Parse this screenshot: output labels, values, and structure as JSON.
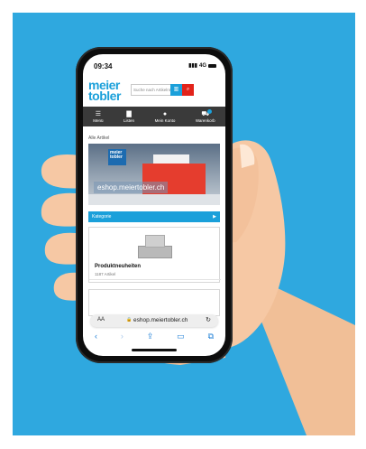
{
  "status": {
    "time": "09:34",
    "network": "4G"
  },
  "header": {
    "logo_line1": "meier",
    "logo_line2": "tobler",
    "search_placeholder": "Suche nach Artikelnr."
  },
  "nav": {
    "items": [
      {
        "label": "Menü",
        "icon": "menu-icon",
        "glyph": "☰"
      },
      {
        "label": "Listen",
        "icon": "list-doc-icon",
        "glyph": "▇"
      },
      {
        "label": "Mein Konto",
        "icon": "user-icon",
        "glyph": "●"
      },
      {
        "label": "Warenkorb",
        "icon": "cart-icon",
        "glyph": "⛟"
      }
    ]
  },
  "main": {
    "section_title": "Alle Artikel",
    "hero_sign_line1": "meier",
    "hero_sign_line2": "tobler",
    "hero_url": "eshop.meiertobler.ch",
    "category_label": "Kategorie",
    "product_card": {
      "name": "Produktneuheiten",
      "count": "1187 Artikel"
    }
  },
  "browser": {
    "aa_label": "AA",
    "url": "eshop.meiertobler.ch",
    "toolbar_icons": [
      "back-icon",
      "forward-icon",
      "share-icon",
      "bookmarks-icon",
      "tabs-icon"
    ]
  },
  "colors": {
    "brand_blue": "#1ba0da",
    "brand_red": "#e2231a",
    "background_blue": "#2fa8df",
    "skin": "#f6c8a4"
  }
}
